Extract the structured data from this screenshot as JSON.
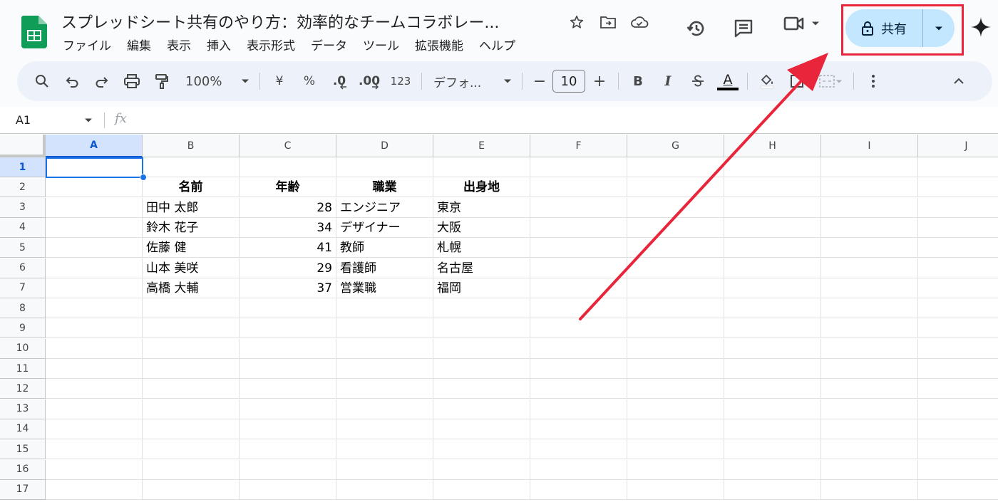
{
  "doc": {
    "title": "スプレッドシート共有のやり方：効率的なチームコラボレー..."
  },
  "menu": [
    "ファイル",
    "編集",
    "表示",
    "挿入",
    "表示形式",
    "データ",
    "ツール",
    "拡張機能",
    "ヘルプ"
  ],
  "share": {
    "label": "共有"
  },
  "toolbar": {
    "zoom": "100%",
    "currency": "¥",
    "percent": "%",
    "dec_decrease": ".0",
    "dec_increase": ".00",
    "number_format": "123",
    "font": "デフォ...",
    "font_size": "10",
    "minus": "−",
    "plus": "+",
    "bold": "B",
    "italic": "I",
    "text_color": "A"
  },
  "formula_bar": {
    "name_box": "A1",
    "fx": "fx"
  },
  "columns": [
    "A",
    "B",
    "C",
    "D",
    "E",
    "F",
    "G",
    "H",
    "I",
    "J"
  ],
  "rows": [
    "1",
    "2",
    "3",
    "4",
    "5",
    "6",
    "7",
    "8",
    "9",
    "10",
    "11",
    "12",
    "13",
    "14",
    "15",
    "16",
    "17"
  ],
  "table": {
    "headers": [
      "名前",
      "年齢",
      "職業",
      "出身地"
    ],
    "records": [
      [
        "田中 太郎",
        "28",
        "エンジニア",
        "東京"
      ],
      [
        "鈴木 花子",
        "34",
        "デザイナー",
        "大阪"
      ],
      [
        "佐藤 健",
        "41",
        "教師",
        "札幌"
      ],
      [
        "山本 美咲",
        "29",
        "看護師",
        "名古屋"
      ],
      [
        "高橋 大輔",
        "37",
        "営業職",
        "福岡"
      ]
    ]
  },
  "colors": {
    "accent": "#0b57d0",
    "share_bg": "#c2e7ff",
    "annotation": "#e8253a"
  },
  "icons": [
    "sheets-logo-icon",
    "star-icon",
    "move-folder-icon",
    "cloud-status-icon",
    "history-icon",
    "comment-icon",
    "meet-video-icon",
    "lock-icon",
    "sparkle-icon"
  ]
}
